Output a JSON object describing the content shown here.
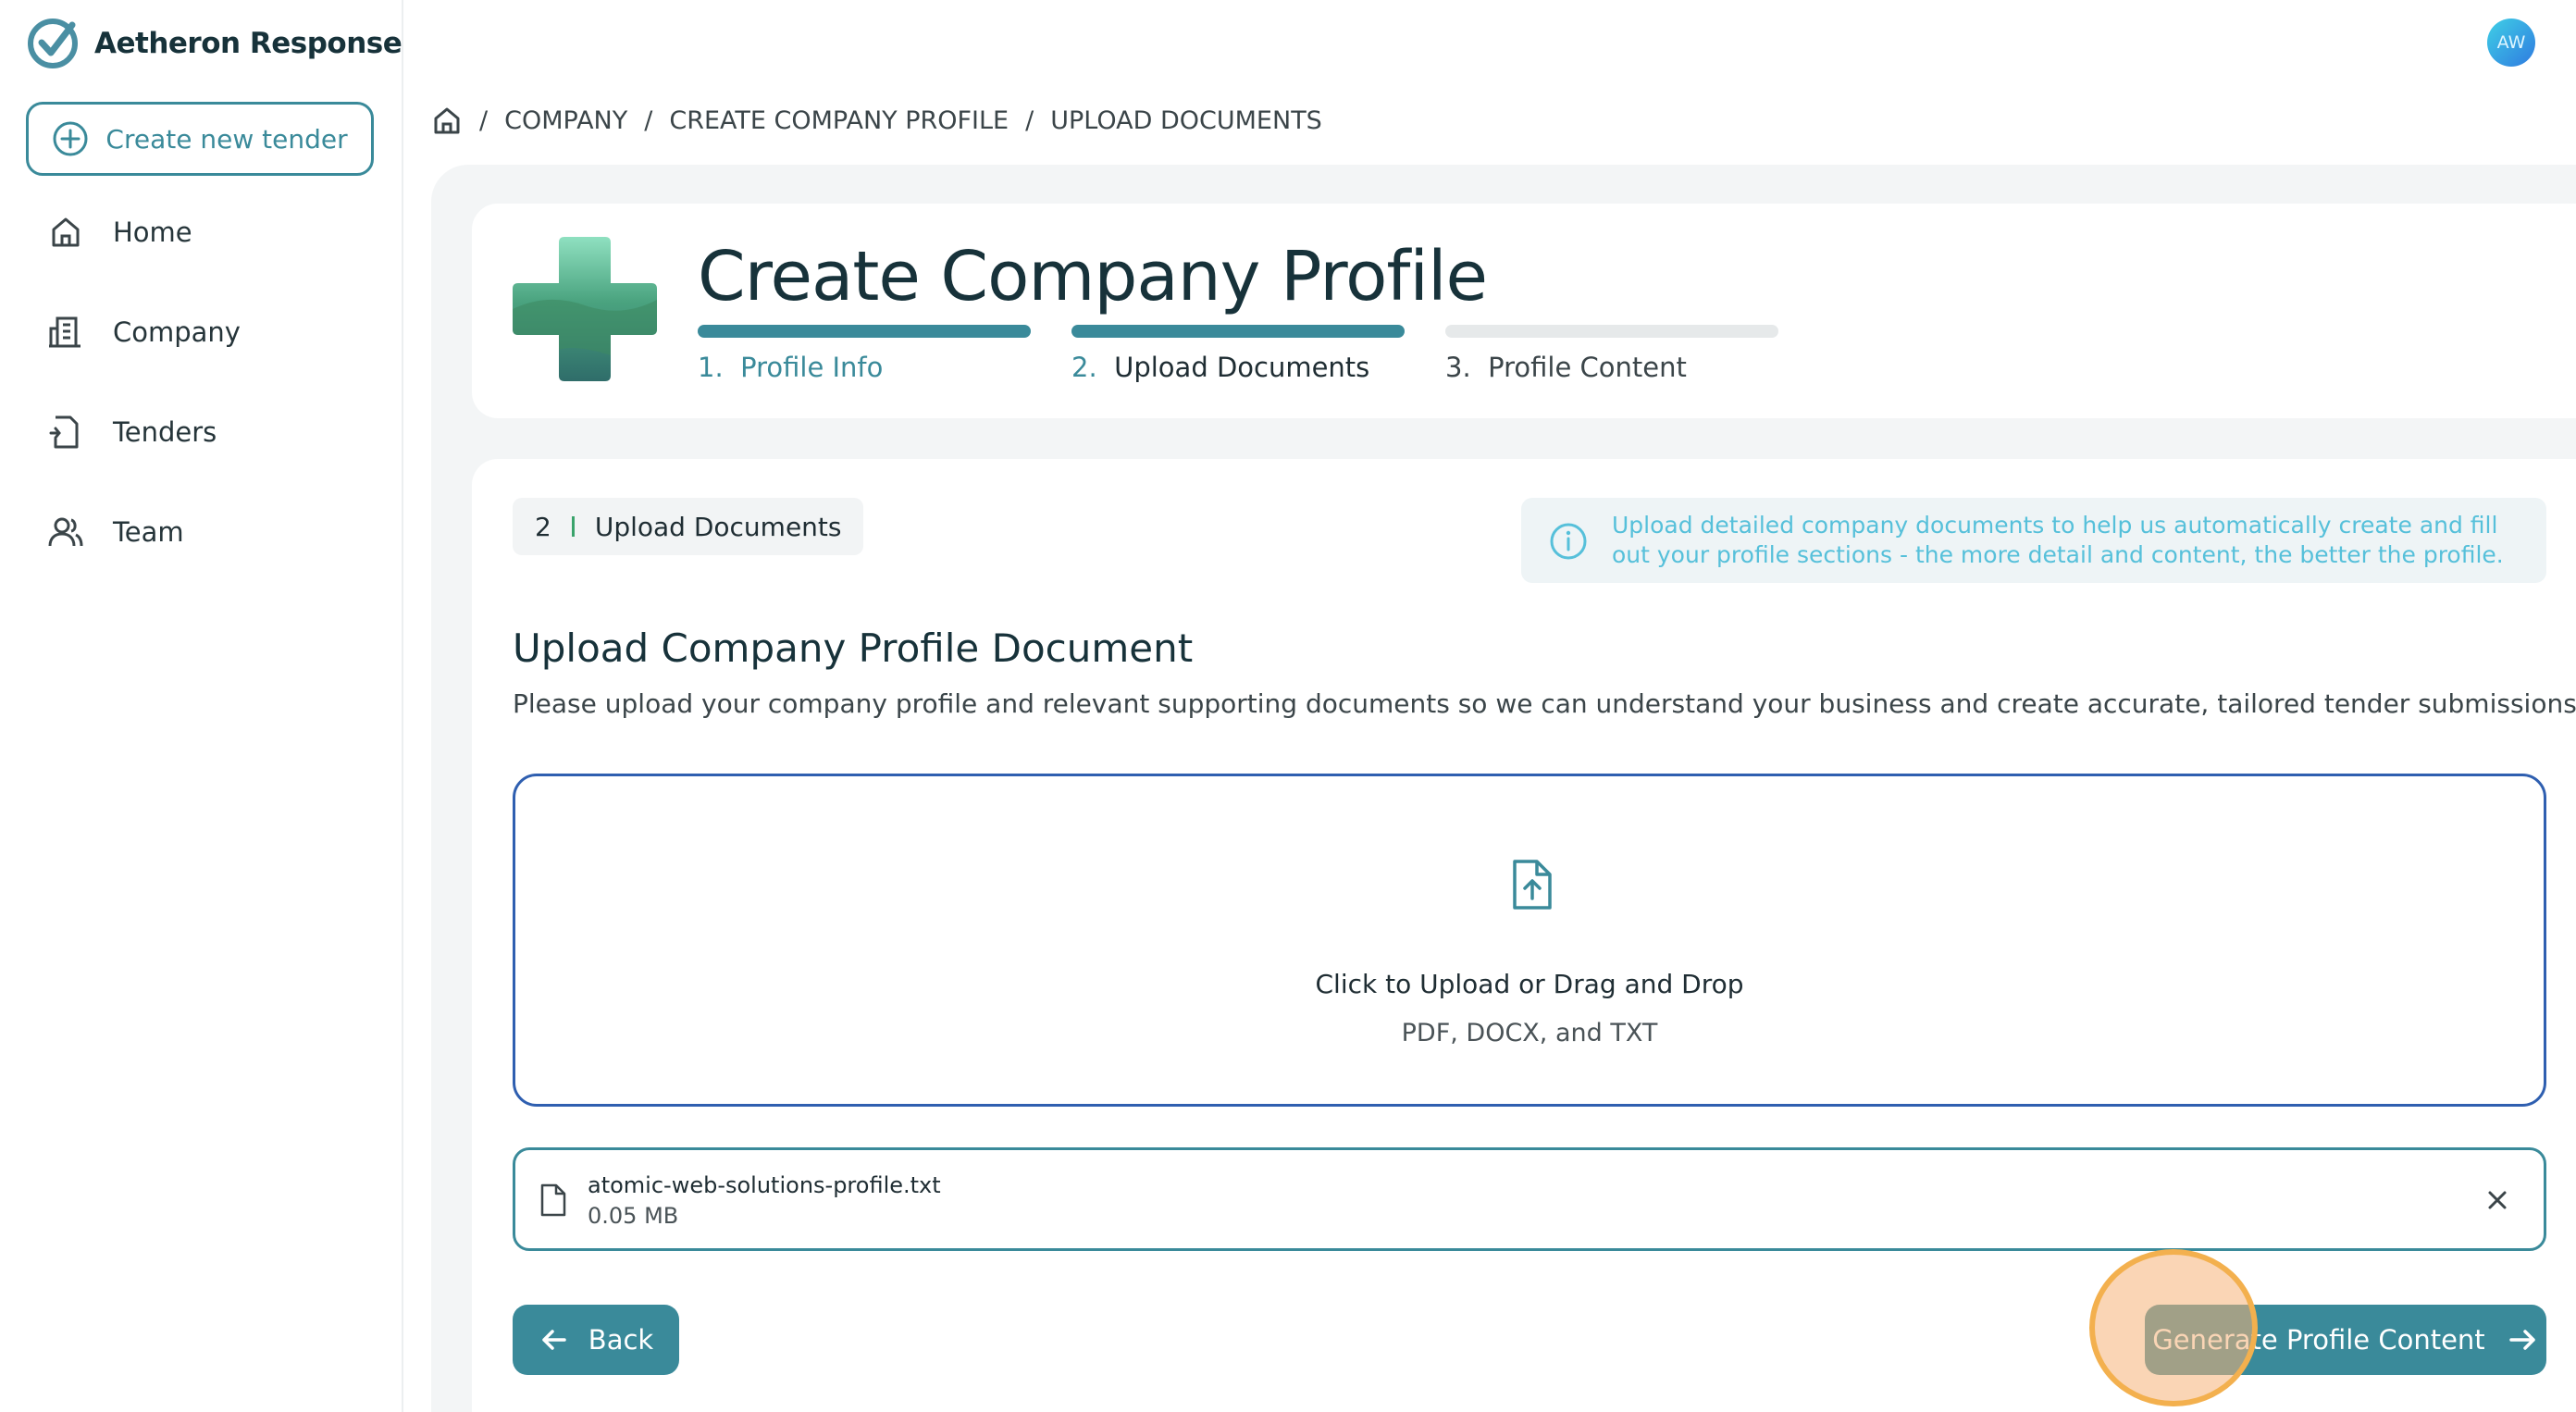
{
  "app": {
    "brand_name": "Aetheron Response",
    "user_initials": "AW",
    "accent_color": "#3a8a9a"
  },
  "sidebar": {
    "create_button_label": "Create new tender",
    "items": [
      {
        "label": "Home",
        "icon": "home-icon"
      },
      {
        "label": "Company",
        "icon": "building-icon"
      },
      {
        "label": "Tenders",
        "icon": "document-icon"
      },
      {
        "label": "Team",
        "icon": "users-icon"
      }
    ]
  },
  "breadcrumb": {
    "items": [
      "COMPANY",
      "CREATE COMPANY PROFILE",
      "UPLOAD DOCUMENTS"
    ],
    "separator": "/"
  },
  "header": {
    "title": "Create Company Profile",
    "steps": [
      {
        "number": "1.",
        "label": "Profile Info",
        "state": "complete"
      },
      {
        "number": "2.",
        "label": "Upload Documents",
        "state": "current"
      },
      {
        "number": "3.",
        "label": "Profile Content",
        "state": "upcoming"
      }
    ]
  },
  "content": {
    "step_badge_number": "2",
    "step_badge_label": "Upload Documents",
    "info_text": "Upload detailed company documents to help us automatically create and fill out your profile sections - the more detail and content, the better the profile.",
    "section_title": "Upload Company Profile Document",
    "section_description": "Please upload your company profile and relevant supporting documents so we can understand your business and create accurate, tailored tender submissions for you.",
    "dropzone": {
      "primary_text": "Click to Upload or Drag and Drop",
      "secondary_text": "PDF, DOCX, and TXT"
    },
    "uploaded_file": {
      "name": "atomic-web-solutions-profile.txt",
      "size": "0.05 MB"
    },
    "back_label": "Back",
    "generate_label": "Generate Profile Content"
  }
}
